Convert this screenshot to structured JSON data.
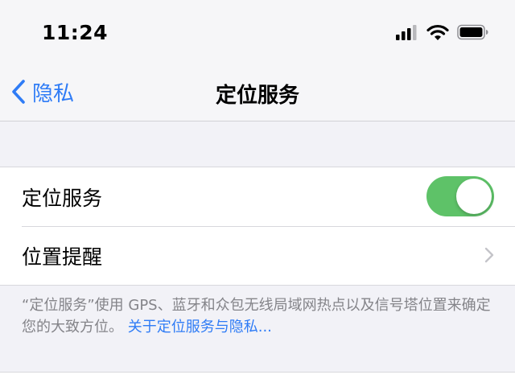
{
  "status_bar": {
    "time": "11:24"
  },
  "nav": {
    "back_label": "隐私",
    "title": "定位服务"
  },
  "settings": {
    "location_services": {
      "label": "定位服务",
      "enabled": true
    },
    "location_alerts": {
      "label": "位置提醒"
    }
  },
  "footnote": {
    "text": "“定位服务”使用 GPS、蓝牙和众包无线局域网热点以及信号塔位置来确定您的大致方位。",
    "link": "关于定位服务与隐私..."
  },
  "colors": {
    "accent": "#2f7cf6",
    "toggle_on": "#5ec268"
  },
  "icons": {
    "back": "chevron-left-icon",
    "disclosure": "chevron-right-icon",
    "signal": "cellular-signal-icon",
    "wifi": "wifi-icon",
    "battery": "battery-icon"
  }
}
